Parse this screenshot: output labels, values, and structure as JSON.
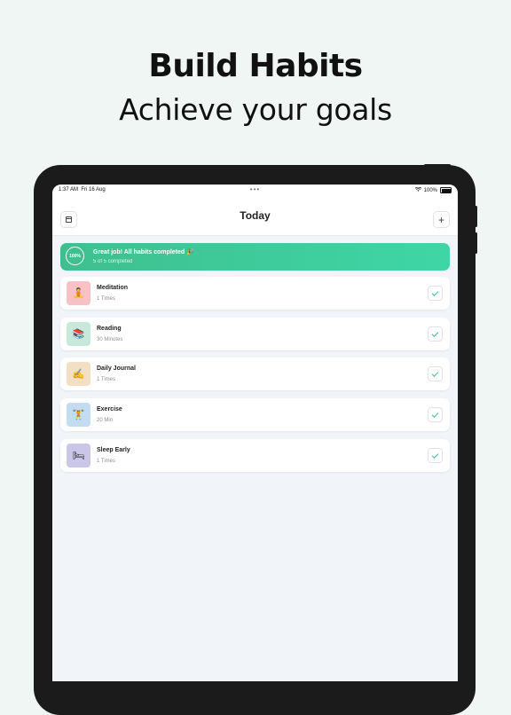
{
  "hero": {
    "title": "Build Habits",
    "subtitle": "Achieve your goals"
  },
  "status_bar": {
    "time": "1:37 AM",
    "date": "Fri 16 Aug",
    "battery": "100%"
  },
  "nav": {
    "title": "Today",
    "left_icon": "calendar-icon",
    "right_icon": "plus-icon"
  },
  "banner": {
    "progress": "100%",
    "message": "Great job! All habits completed 🎉",
    "sub": "5 of 5 completed",
    "colors": [
      "#3fbf8f",
      "#3fd6a6"
    ]
  },
  "habits": [
    {
      "name": "Meditation",
      "meta": "1 Times",
      "icon": "🧘",
      "icon_bg": "#f7c1c6",
      "completed": true
    },
    {
      "name": "Reading",
      "meta": "30 Minutes",
      "icon": "📚",
      "icon_bg": "#c9e8dc",
      "completed": true
    },
    {
      "name": "Daily Journal",
      "meta": "1 Times",
      "icon": "✍",
      "icon_bg": "#f3dfc3",
      "completed": true
    },
    {
      "name": "Exercise",
      "meta": "20 Min",
      "icon": "🏋",
      "icon_bg": "#c2dcf1",
      "completed": true
    },
    {
      "name": "Sleep Early",
      "meta": "1 Times",
      "icon": "🛏",
      "icon_bg": "#c9c6e7",
      "completed": true
    }
  ]
}
